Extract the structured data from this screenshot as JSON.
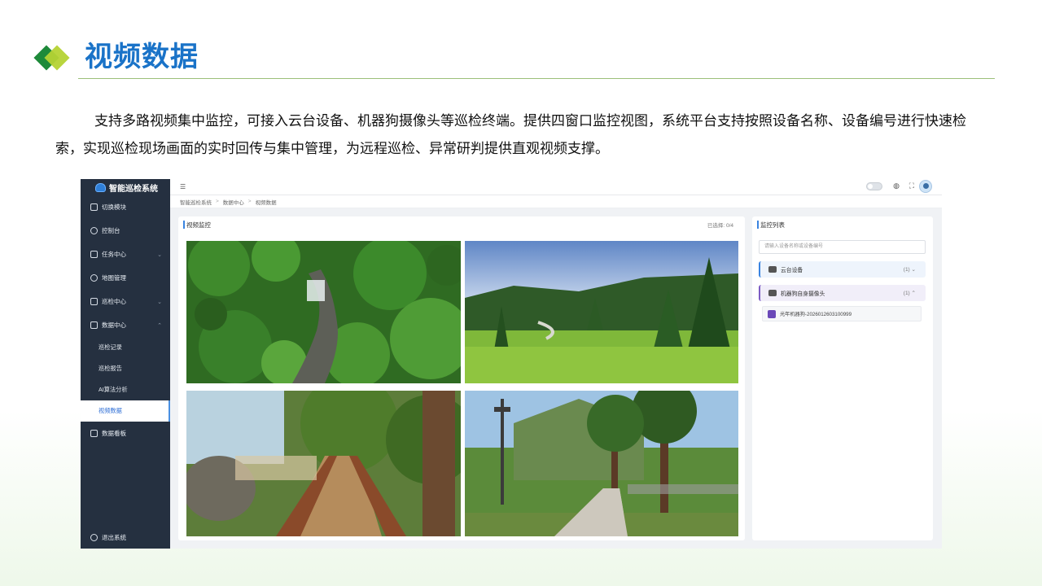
{
  "slide": {
    "title": "视频数据",
    "description": "支持多路视频集中监控，可接入云台设备、机器狗摄像头等巡检终端。提供四窗口监控视图，系统平台支持按照设备名称、设备编号进行快速检索，实现巡检现场画面的实时回传与集中管理，为远程巡检、异常研判提供直观视频支撑。"
  },
  "app": {
    "brand": "智能巡检系统",
    "sidebar": {
      "items": [
        {
          "label": "切换模块",
          "icon": "grid-icon"
        },
        {
          "label": "控制台",
          "icon": "dashboard-icon"
        },
        {
          "label": "任务中心",
          "icon": "task-icon",
          "chevron": "⌄"
        },
        {
          "label": "地图管理",
          "icon": "map-icon"
        },
        {
          "label": "巡检中心",
          "icon": "inspection-icon",
          "chevron": "⌄"
        },
        {
          "label": "数据中心",
          "icon": "data-icon",
          "chevron": "⌃"
        }
      ],
      "sub_items": [
        "巡检记录",
        "巡检报告",
        "AI算法分析",
        "视频数据"
      ],
      "active_sub": "视频数据",
      "after": {
        "label": "数据看板",
        "icon": "board-icon"
      },
      "logout": "退出系统"
    },
    "breadcrumb": [
      "智能巡检系统",
      "数据中心",
      "视频数据"
    ],
    "video_panel": {
      "title": "视频监控",
      "selected": "已选择: 0/4"
    },
    "list_panel": {
      "title": "监控列表",
      "search_placeholder": "请输入设备名称或设备编号",
      "groups": [
        {
          "label": "云台设备",
          "count": "(1)",
          "chevron": "⌄"
        },
        {
          "label": "机器狗自身摄像头",
          "count": "(1)",
          "chevron": "⌃"
        }
      ],
      "device": "光年机器狗-2026012603100999"
    }
  }
}
